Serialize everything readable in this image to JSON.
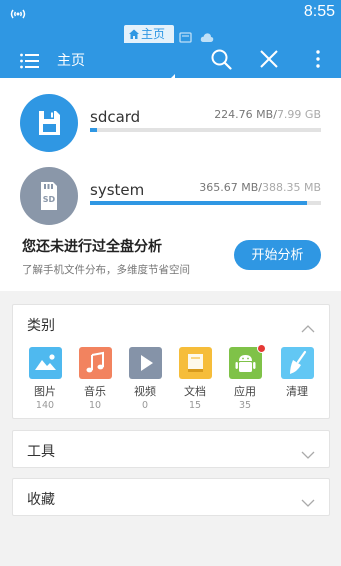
{
  "status_bar": {
    "time": "8:55"
  },
  "tabs": {
    "active_label": "主页"
  },
  "toolbar": {
    "title": "主页"
  },
  "storage": [
    {
      "name": "sdcard",
      "used": "224.76 MB",
      "total": "7.99 GB",
      "usage_fraction": 0.03
    },
    {
      "name": "system",
      "used": "365.67 MB",
      "total": "388.35 MB",
      "usage_fraction": 0.94
    }
  ],
  "disk_icon_text": "SD",
  "analysis": {
    "title": "您还未进行过全盘分析",
    "subtitle": "了解手机文件分布，多维度节省空间",
    "button_label": "开始分析"
  },
  "categories_panel": {
    "title": "类别",
    "items": [
      {
        "label": "图片",
        "count": "140",
        "icon": "image-icon",
        "color": "#4fb9ef"
      },
      {
        "label": "音乐",
        "count": "10",
        "icon": "music-icon",
        "color": "#f2835f"
      },
      {
        "label": "视频",
        "count": "0",
        "icon": "video-icon",
        "color": "#8593a8"
      },
      {
        "label": "文档",
        "count": "15",
        "icon": "document-icon",
        "color": "#f6bd3a"
      },
      {
        "label": "应用",
        "count": "35",
        "icon": "android-icon",
        "color": "#7fc248"
      },
      {
        "label": "清理",
        "count": "",
        "icon": "broom-icon",
        "color": "#62c7f4"
      }
    ]
  },
  "tools_panel": {
    "title": "工具"
  },
  "favorites_panel": {
    "title": "收藏"
  },
  "colors": {
    "accent": "#2f97e3",
    "background": "#f2f2f2"
  }
}
